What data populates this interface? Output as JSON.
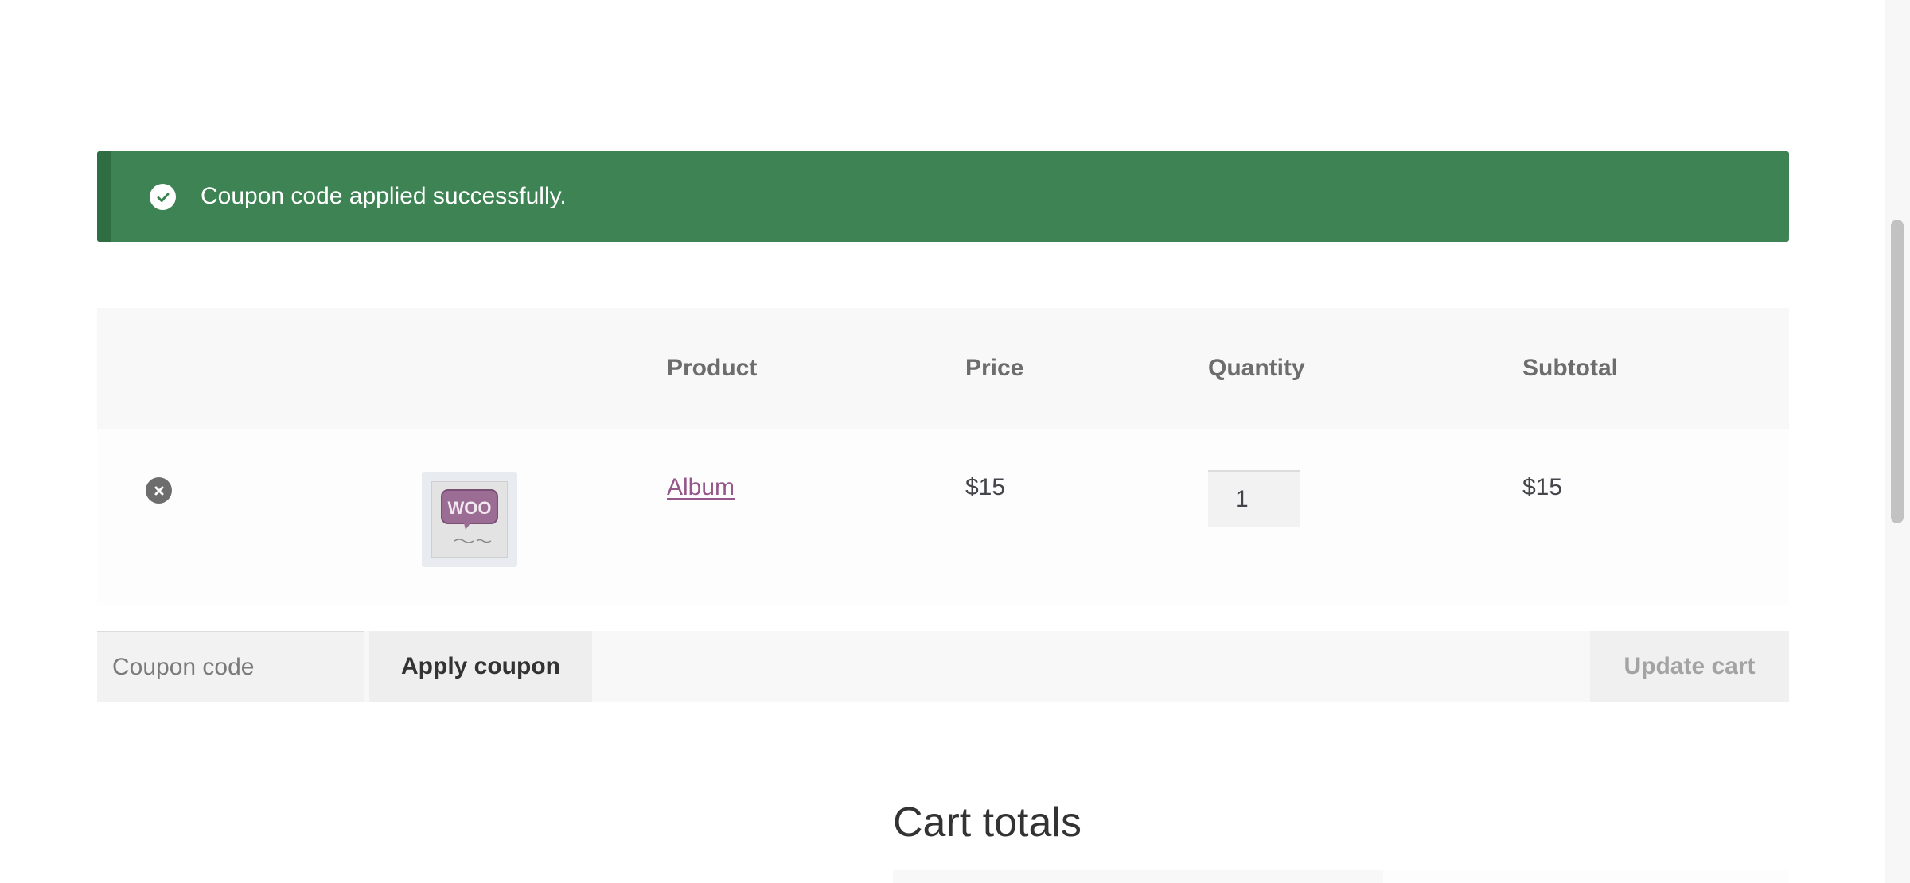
{
  "notice": {
    "message": "Coupon code applied successfully.",
    "icon": "checkmark-circle-icon",
    "color": "#3d8353"
  },
  "cart": {
    "columns": {
      "product": "Product",
      "price": "Price",
      "quantity": "Quantity",
      "subtotal": "Subtotal"
    },
    "items": [
      {
        "name": "Album",
        "price": "$15",
        "quantity": "1",
        "subtotal": "$15",
        "thumbnail_text": "WOO",
        "remove_icon": "remove-circle-icon"
      }
    ]
  },
  "actions": {
    "coupon_placeholder": "Coupon code",
    "coupon_value": "",
    "apply_label": "Apply coupon",
    "update_label": "Update cart"
  },
  "totals": {
    "title": "Cart totals"
  },
  "colors": {
    "link": "#96588a",
    "notice_bg": "#3d8353"
  }
}
